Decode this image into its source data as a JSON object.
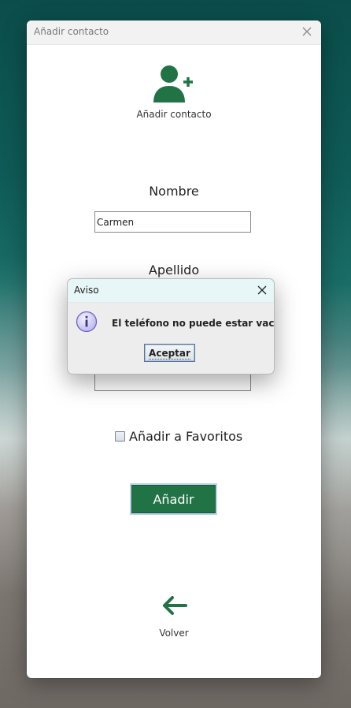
{
  "window": {
    "title": "Añadir contacto",
    "header_icon": "add-user-icon",
    "header_label": "Añadir contacto",
    "accent_color": "#217346"
  },
  "form": {
    "nombre_label": "Nombre",
    "nombre_value": "Carmen",
    "apellido_label": "Apellido",
    "telefono_value": "",
    "favorites_label": "Añadir a Favoritos",
    "favorites_checked": false,
    "submit_label": "Añadir"
  },
  "footer": {
    "back_icon": "arrow-left-icon",
    "back_label": "Volver"
  },
  "dialog": {
    "title": "Aviso",
    "icon": "info-icon",
    "message": "El teléfono no puede estar vacio",
    "button_label": "Aceptar"
  }
}
